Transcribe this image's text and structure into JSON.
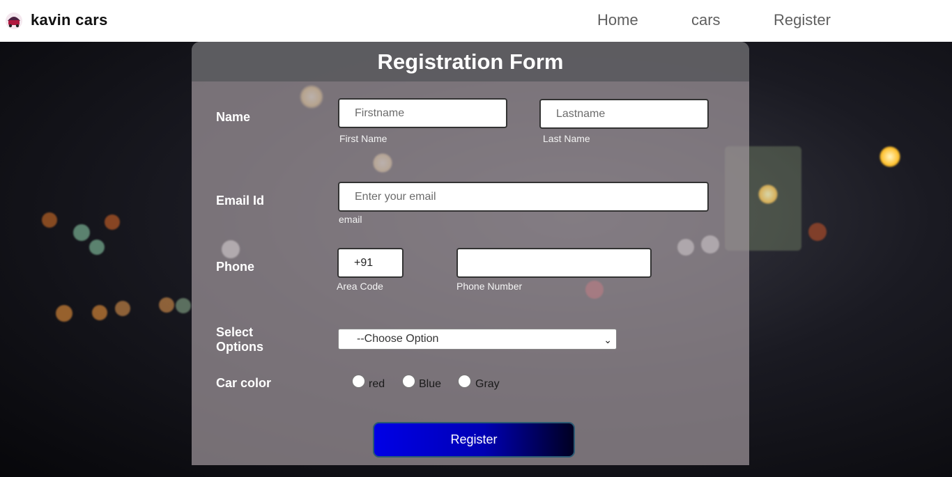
{
  "header": {
    "brand": "kavin cars",
    "nav": [
      "Home",
      "cars",
      "Register"
    ]
  },
  "form": {
    "title": "Registration Form",
    "name": {
      "label": "Name",
      "first_placeholder": "Firstname",
      "first_caption": "First Name",
      "last_placeholder": "Lastname",
      "last_caption": "Last Name"
    },
    "email": {
      "label": "Email Id",
      "placeholder": "Enter your email",
      "caption": "email"
    },
    "phone": {
      "label": "Phone",
      "area_value": "+91",
      "area_caption": "Area Code",
      "number_value": "",
      "number_caption": "Phone Number"
    },
    "options": {
      "label": "Select Options",
      "selected": "--Choose Option"
    },
    "car_color": {
      "label": "Car color",
      "choices": [
        "red",
        "Blue",
        "Gray"
      ]
    },
    "submit_label": "Register"
  },
  "colors": {
    "header_bg": "#ffffff",
    "card_title_bg": "#5a5a5e",
    "button_start": "#0000e6",
    "button_end": "#000022"
  },
  "icons": {
    "logo": "car-logo-icon",
    "select_arrow": "chevron-down-icon"
  }
}
